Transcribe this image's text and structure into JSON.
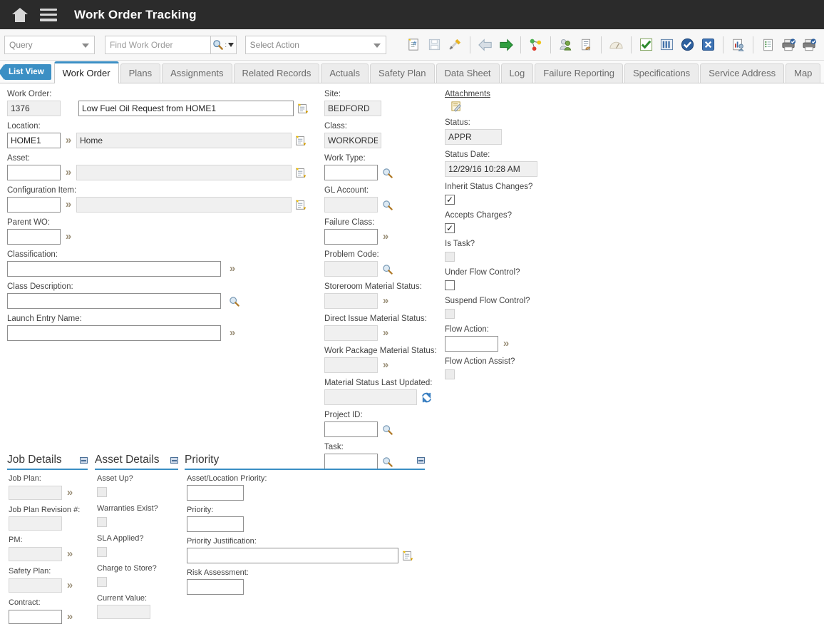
{
  "header": {
    "title": "Work Order Tracking",
    "home_icon": "home-icon",
    "menu_icon": "hamburger-menu-icon"
  },
  "toolbar": {
    "query_select": "Query",
    "find_placeholder": "Find Work Order",
    "find_value": "",
    "search_icon": "search-icon",
    "select_action": "Select Action",
    "buttons": [
      {
        "name": "new-work-order-button",
        "icon": "new-record-icon"
      },
      {
        "name": "save-button",
        "icon": "save-disk-icon"
      },
      {
        "name": "clear-changes-button",
        "icon": "pencil-eraser-icon"
      },
      {
        "name": "previous-record-button",
        "icon": "arrow-left-icon"
      },
      {
        "name": "next-record-button",
        "icon": "arrow-right-icon"
      },
      {
        "name": "workflow-button",
        "icon": "workflow-nodes-icon"
      },
      {
        "name": "assignment-manager-button",
        "icon": "person-assign-icon"
      },
      {
        "name": "view-history-button",
        "icon": "document-hand-icon"
      },
      {
        "name": "gauge-button",
        "icon": "gauge-icon"
      },
      {
        "name": "approve-button",
        "icon": "green-check-icon"
      },
      {
        "name": "report-button",
        "icon": "bar-chart-icon"
      },
      {
        "name": "complete-button",
        "icon": "blue-check-circle-icon"
      },
      {
        "name": "close-button",
        "icon": "blue-x-icon"
      },
      {
        "name": "ledger-person-button",
        "icon": "report-person-icon"
      },
      {
        "name": "list-report-button",
        "icon": "list-document-icon"
      },
      {
        "name": "print-button",
        "icon": "printer-check-icon"
      },
      {
        "name": "print-preview-button",
        "icon": "printer-check-2-icon"
      }
    ]
  },
  "tabs": {
    "list_view": "List View",
    "items": [
      {
        "label": "Work Order",
        "active": true
      },
      {
        "label": "Plans",
        "active": false
      },
      {
        "label": "Assignments",
        "active": false
      },
      {
        "label": "Related Records",
        "active": false
      },
      {
        "label": "Actuals",
        "active": false
      },
      {
        "label": "Safety Plan",
        "active": false
      },
      {
        "label": "Data Sheet",
        "active": false
      },
      {
        "label": "Log",
        "active": false
      },
      {
        "label": "Failure Reporting",
        "active": false
      },
      {
        "label": "Specifications",
        "active": false
      },
      {
        "label": "Service Address",
        "active": false
      },
      {
        "label": "Map",
        "active": false
      }
    ]
  },
  "form": {
    "left": {
      "work_order_label": "Work Order:",
      "work_order_id": "1376",
      "work_order_desc": "Low Fuel Oil Request from HOME1",
      "location_label": "Location:",
      "location_id": "HOME1",
      "location_desc": "Home",
      "asset_label": "Asset:",
      "asset_id": "",
      "asset_desc": "",
      "config_item_label": "Configuration Item:",
      "config_item_id": "",
      "config_item_desc": "",
      "parent_wo_label": "Parent WO:",
      "parent_wo": "",
      "classification_label": "Classification:",
      "classification": "",
      "class_description_label": "Class Description:",
      "class_description": "",
      "launch_entry_label": "Launch Entry Name:",
      "launch_entry": ""
    },
    "middle": {
      "site_label": "Site:",
      "site": "BEDFORD",
      "class_label": "Class:",
      "class": "WORKORDER",
      "work_type_label": "Work Type:",
      "work_type": "",
      "gl_account_label": "GL Account:",
      "gl_account": "",
      "failure_class_label": "Failure Class:",
      "failure_class": "",
      "problem_code_label": "Problem Code:",
      "problem_code": "",
      "storeroom_status_label": "Storeroom Material Status:",
      "storeroom_status": "",
      "direct_issue_status_label": "Direct Issue Material Status:",
      "direct_issue_status": "",
      "work_package_status_label": "Work Package Material Status:",
      "work_package_status": "",
      "material_updated_label": "Material Status Last Updated:",
      "material_updated": "",
      "project_id_label": "Project ID:",
      "project_id": "",
      "task_label": "Task:",
      "task": ""
    },
    "right": {
      "attachments_label": "Attachments",
      "attachments_icon": "attachment-note-icon",
      "status_label": "Status:",
      "status": "APPR",
      "status_date_label": "Status Date:",
      "status_date": "12/29/16 10:28 AM",
      "inherit_status_label": "Inherit Status Changes?",
      "inherit_status_checked": true,
      "accepts_charges_label": "Accepts Charges?",
      "accepts_charges_checked": true,
      "is_task_label": "Is Task?",
      "is_task_checked": false,
      "under_flow_label": "Under Flow Control?",
      "under_flow_checked": false,
      "suspend_flow_label": "Suspend Flow Control?",
      "suspend_flow_checked": false,
      "flow_action_label": "Flow Action:",
      "flow_action": "",
      "flow_action_assist_label": "Flow Action Assist?",
      "flow_action_assist_checked": false
    }
  },
  "panels": {
    "job_details": {
      "title": "Job Details",
      "fields": [
        {
          "label": "Job Plan:",
          "value": "",
          "readonly": true,
          "chevron": true
        },
        {
          "label": "Job Plan Revision #:",
          "value": "",
          "readonly": true,
          "chevron": false
        },
        {
          "label": "PM:",
          "value": "",
          "readonly": true,
          "chevron": true
        },
        {
          "label": "Safety Plan:",
          "value": "",
          "readonly": true,
          "chevron": true
        },
        {
          "label": "Contract:",
          "value": "",
          "readonly": false,
          "chevron": true
        }
      ]
    },
    "asset_details": {
      "title": "Asset Details",
      "fields": [
        {
          "label": "Asset Up?",
          "type": "checkbox",
          "checked": false
        },
        {
          "label": "Warranties Exist?",
          "type": "checkbox",
          "checked": false
        },
        {
          "label": "SLA Applied?",
          "type": "checkbox",
          "checked": false
        },
        {
          "label": "Charge to Store?",
          "type": "checkbox",
          "checked": false
        },
        {
          "label": "Current Value:",
          "type": "text",
          "value": "",
          "readonly": true
        }
      ]
    },
    "priority": {
      "title": "Priority",
      "fields": [
        {
          "label": "Asset/Location Priority:",
          "value": "",
          "width": "sw80"
        },
        {
          "label": "Priority:",
          "value": "",
          "width": "sw80"
        },
        {
          "label": "Priority Justification:",
          "value": "",
          "width": "sw297",
          "icon": "detail-menu-icon"
        },
        {
          "label": "Risk Assessment:",
          "value": "",
          "width": "sw80"
        }
      ]
    }
  },
  "colors": {
    "header_bg": "#2b2b2b",
    "accent": "#3b8fc4",
    "readonly_bg": "#f0f0f0"
  }
}
